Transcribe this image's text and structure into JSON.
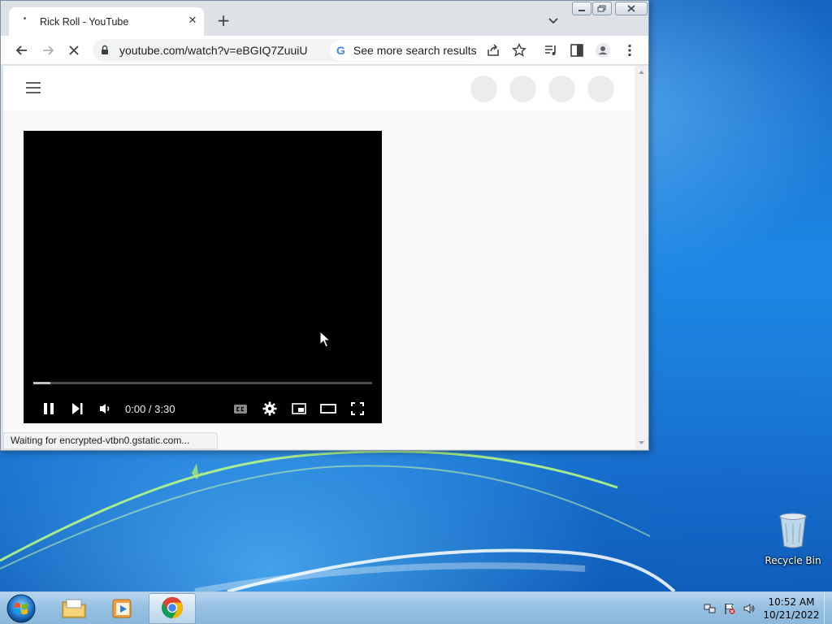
{
  "browser": {
    "tab_title": "Rick Roll - YouTube",
    "url": "youtube.com/watch?v=eBGIQ7ZuuiU",
    "omnibox_suggestion": "See more search results",
    "omnibox_suggestion_logo": "G",
    "status_text": "Waiting for encrypted-vtbn0.gstatic.com..."
  },
  "player": {
    "time": "0:00 / 3:30",
    "progress": 0.05
  },
  "desktop": {
    "recycle_bin_label": "Recycle Bin"
  },
  "taskbar": {
    "clock_time": "10:52 AM",
    "clock_date": "10/21/2022"
  },
  "colors": {
    "google_blue": "#4285f4",
    "chrome_red": "#db4437",
    "chrome_yellow": "#f4b400",
    "chrome_green": "#0f9d58"
  }
}
